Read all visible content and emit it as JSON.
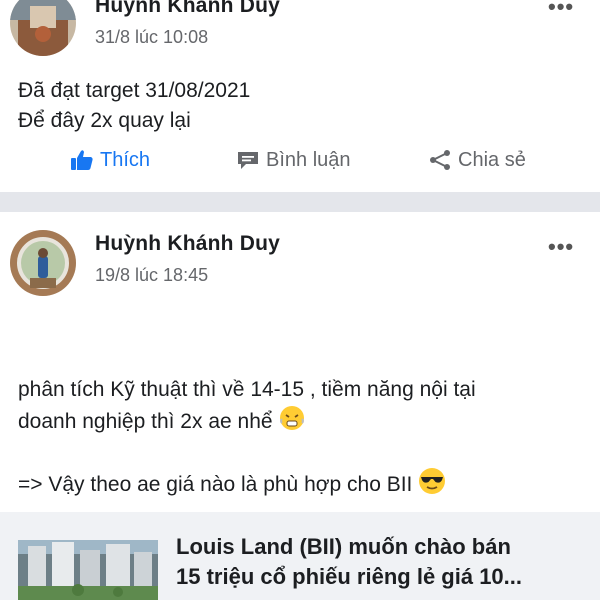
{
  "post1": {
    "author": "Huỳnh Khánh Duy",
    "timestamp": "31/8 lúc 10:08",
    "more": "•••",
    "lines": [
      "Đã đạt target 31/08/2021",
      "Để đây 2x quay lại"
    ]
  },
  "actions": {
    "like": "Thích",
    "comment": "Bình luận",
    "share": "Chia sẻ"
  },
  "post2": {
    "author": "Huỳnh Khánh Duy",
    "timestamp": "19/8 lúc 18:45",
    "more": "•••",
    "lines": [
      "phân tích Kỹ thuật thì về 14-15 , tiềm năng nội tại",
      "doanh nghiệp thì 2x ae nhể",
      "=> Vậy theo ae giá nào là phù hợp cho BII"
    ],
    "link_preview": {
      "title_lines": [
        "Louis Land (BII) muốn chào bán",
        "15 triệu cổ phiếu riêng lẻ giá 10..."
      ]
    }
  },
  "colors": {
    "accent": "#1877f2",
    "muted": "#65676b",
    "separator": "#e4e6eb",
    "card_bg": "#f0f2f5"
  },
  "icons": [
    "like-thumb-icon",
    "comment-icon",
    "share-icon",
    "more-icon",
    "steam-nose-emoji-icon",
    "sunglasses-emoji-icon"
  ]
}
